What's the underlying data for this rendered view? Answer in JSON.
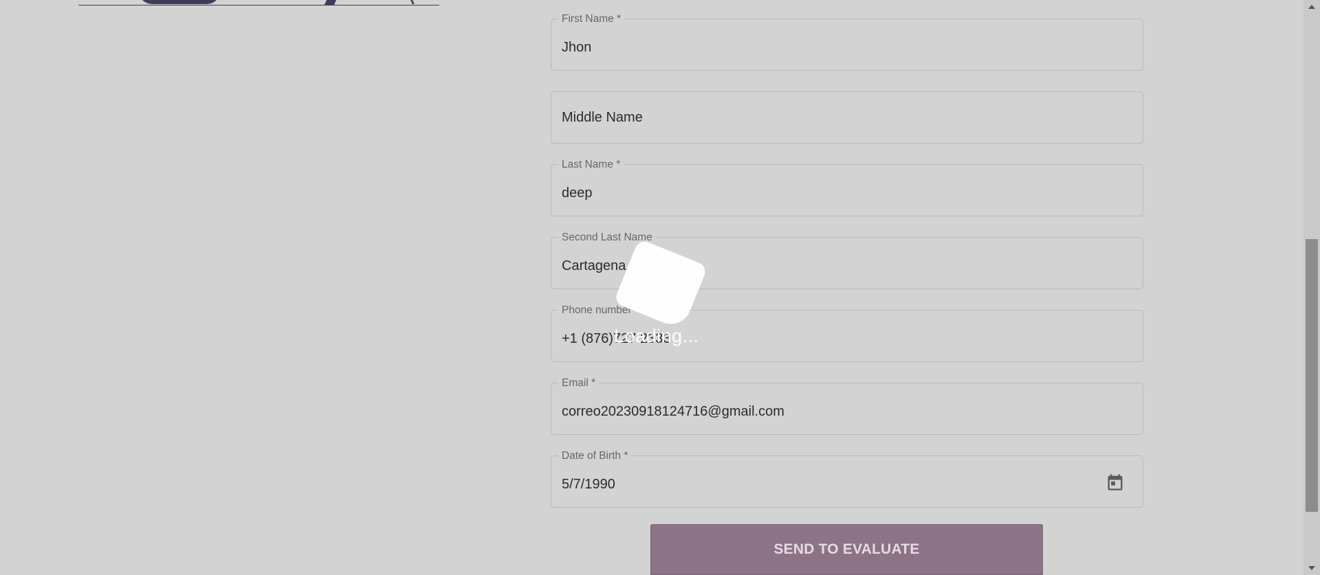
{
  "form": {
    "first_name": {
      "label": "First Name *",
      "value": "Jhon"
    },
    "middle_name": {
      "placeholder": "Middle Name"
    },
    "last_name": {
      "label": "Last Name *",
      "value": "deep"
    },
    "second_last_name": {
      "label": "Second Last Name",
      "value": "Cartagena"
    },
    "phone": {
      "label": "Phone number *",
      "value": "+1 (876)727 2333"
    },
    "email": {
      "label": "Email *",
      "value": "correo20230918124716@gmail.com"
    },
    "dob": {
      "label": "Date of Birth *",
      "value": "5/7/1990",
      "icon": "calendar-icon"
    },
    "submit_label": "SEND TO EVALUATE"
  },
  "overlay": {
    "loading_text": "Loading..."
  },
  "colors": {
    "background": "#d3d3d3",
    "button": "#8c7385",
    "field_border": "#b9b9b9"
  }
}
